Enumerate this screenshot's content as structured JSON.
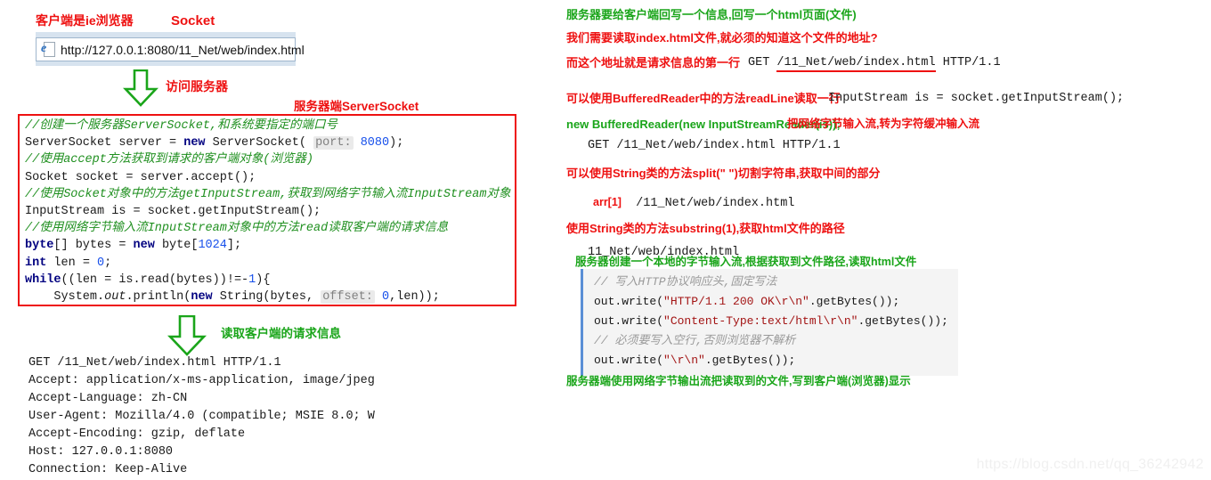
{
  "left": {
    "label_client": "客户端是ie浏览器",
    "label_socket": "Socket",
    "browser": {
      "url": "http://127.0.0.1:8080/11_Net/web/index.html",
      "icon": "ie-browser-icon"
    },
    "arrow1_label": "访问服务器",
    "label_serversocket": "服务器端ServerSocket",
    "code": {
      "line1_comment": "//创建一个服务器ServerSocket,和系统要指定的端口号",
      "line2": "ServerSocket server = new ServerSocket( port: 8080);",
      "line2_kw": "new",
      "line2_a": "ServerSocket server = ",
      "line2_b": " ServerSocket(",
      "line2_hint": "port:",
      "line2_num": "8080",
      "line2_c": ");",
      "line3_comment": "//使用accept方法获取到请求的客户端对象(浏览器)",
      "line4": "Socket socket = server.accept();",
      "line5_comment": "//使用Socket对象中的方法getInputStream,获取到网络字节输入流InputStream对象",
      "line6": "InputStream is = socket.getInputStream();",
      "line7_comment": "//使用网络字节输入流InputStream对象中的方法read读取客户端的请求信息",
      "line8_kw1": "byte",
      "line8_a": "[] bytes = ",
      "line8_kw2": "new",
      "line8_b": " byte[",
      "line8_num": "1024",
      "line8_c": "];",
      "line9_kw": "int",
      "line9_a": " len = ",
      "line9_num": "0",
      "line9_b": ";",
      "line10_kw": "while",
      "line10_a": "((len = is.read(bytes))!=-",
      "line10_num": "1",
      "line10_b": "){",
      "line11_a": "    System.",
      "line11_out": "out",
      "line11_b": ".println(",
      "line11_kw": "new",
      "line11_c": " String(bytes, ",
      "line11_hint": "offset:",
      "line11_num": "0",
      "line11_d": ",len));",
      "line12": "}"
    },
    "arrow2_label": "读取客户端的请求信息",
    "request": [
      "GET /11_Net/web/index.html HTTP/1.1",
      "Accept: application/x-ms-application, image/jpeg",
      "Accept-Language: zh-CN",
      "User-Agent: Mozilla/4.0 (compatible; MSIE 8.0; W",
      "Accept-Encoding: gzip, deflate",
      "Host: 127.0.0.1:8080",
      "Connection: Keep-Alive"
    ]
  },
  "right": {
    "note1": "服务器要给客户端回写一个信息,回写一个html页面(文件)",
    "note2": "我们需要读取index.html文件,就必须的知道这个文件的地址?",
    "note3": "而这个地址就是请求信息的第一行",
    "req_line_get": "GET ",
    "req_line_path": "/11_Net/web/index.html",
    "req_line_ver": " HTTP/1.1",
    "note4": "可以使用BufferedReader中的方法readLine读取一行",
    "code_inputstream": "InputStream is = socket.getInputStream();",
    "note5": "new BufferedReader(new InputStreamReader(is));",
    "note5_tail": "is",
    "note6": "把网络字节输入流,转为字符缓冲输入流",
    "req_line_plain": "GET /11_Net/web/index.html HTTP/1.1",
    "note7": "可以使用String类的方法split(\" \")切割字符串,获取中间的部分",
    "arr_label": "arr[1]",
    "arr_value": "/11_Net/web/index.html",
    "note8": "使用String类的方法substring(1),获取html文件的路径",
    "path_value": "11_Net/web/index.html",
    "note9": "服务器创建一个本地的字节输入流,根据获取到文件路径,读取html文件",
    "resp_code": {
      "c1": "// 写入HTTP协议响应头,固定写法",
      "l2_a": "out.write(",
      "l2_s": "\"HTTP/1.1 200 OK\\r\\n\"",
      "l2_b": ".getBytes());",
      "l3_a": "out.write(",
      "l3_s": "\"Content-Type:text/html\\r\\n\"",
      "l3_b": ".getBytes());",
      "c2": "// 必须要写入空行,否则浏览器不解析",
      "l5_a": "out.write(",
      "l5_s": "\"\\r\\n\"",
      "l5_b": ".getBytes());"
    },
    "note10": "服务器端使用网络字节输出流把读取到的文件,写到客户端(浏览器)显示"
  },
  "watermark": "https://blog.csdn.net/qq_36242942",
  "colors": {
    "red": "#ee1111",
    "green": "#1aa51a",
    "code_comment": "#209020",
    "keyword": "#000080",
    "number": "#1750eb",
    "box_border": "#ee1111",
    "resp_bg": "#f4f4f4",
    "resp_border": "#5a8fd6"
  }
}
